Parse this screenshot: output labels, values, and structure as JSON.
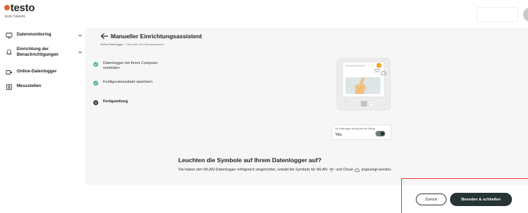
{
  "brand": {
    "name": "testo",
    "subtitle": "testo Saveris",
    "accent": "#e8632a"
  },
  "sidebar": {
    "items": [
      {
        "label": "Datenmonitoring",
        "icon": "monitor-icon",
        "has_chevron": true
      },
      {
        "label": "Einrichtung der Benachrichtigungen",
        "icon": "bell-icon",
        "has_chevron": true
      },
      {
        "label": "Online-Datenlogger",
        "icon": "logger-icon",
        "has_chevron": false
      },
      {
        "label": "Messstellen",
        "icon": "measuring-point-icon",
        "has_chevron": false
      }
    ]
  },
  "page": {
    "title": "Manueller Einrichtungsassistent",
    "breadcrumb": [
      "Online-Datenlogger",
      "Manueller Einrichtungsassistent"
    ],
    "breadcrumb_separator": "/"
  },
  "steps": [
    {
      "number": "1",
      "label": "Datenlogger mit Ihrem Computer verbinden",
      "status": "done"
    },
    {
      "number": "2",
      "label": "Konfigurationsdatei speichern",
      "status": "done"
    },
    {
      "number": "3",
      "label": "Fertigstellung",
      "status": "active"
    }
  ],
  "hint": {
    "text": "Die Datenlogger verfügt über ein Display",
    "value": "Yes",
    "toggle_on": true
  },
  "content": {
    "heading": "Leuchten die Symbole auf Ihrem Datenlogger auf?",
    "desc_part1": "Sie haben den WLAN-Datenlogger erfolgreich eingerichtet, sobald die Symbole für WLAN",
    "desc_part2": "und Cloud",
    "desc_part3": "angezeigt werden."
  },
  "footer": {
    "back_label": "Zurück",
    "finish_label": "Beenden & schließen"
  },
  "colors": {
    "step_done": "#56b38b",
    "primary_button": "#263433",
    "highlight": "#e5392f"
  }
}
